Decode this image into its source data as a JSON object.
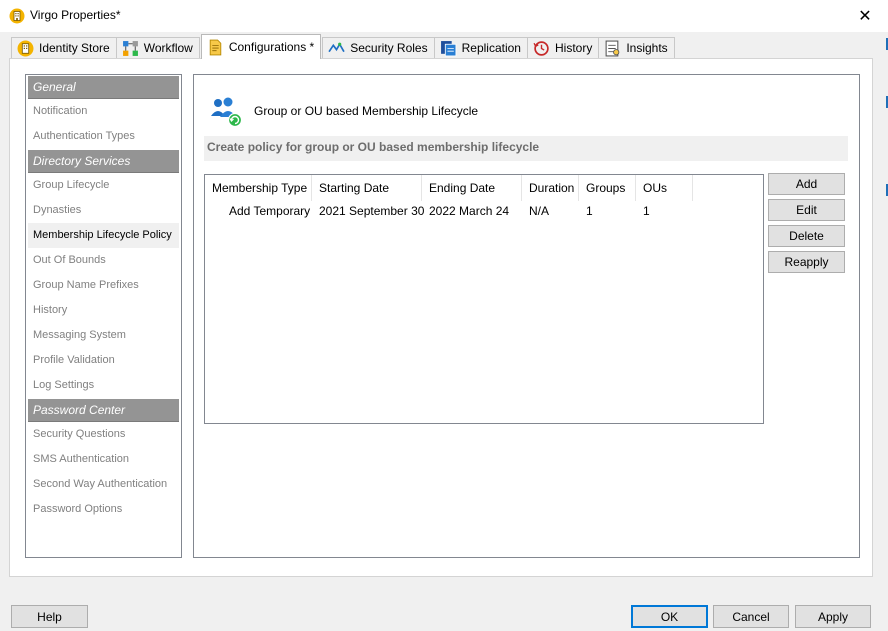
{
  "window": {
    "title": "Virgo Properties*",
    "app_icon": "building-icon",
    "close_symbol": "✕"
  },
  "tabs": [
    {
      "label": "Identity Store",
      "icon": "building-icon"
    },
    {
      "label": "Workflow",
      "icon": "workflow-icon"
    },
    {
      "label": "Configurations *",
      "icon": "document-icon",
      "active": true
    },
    {
      "label": "Security Roles",
      "icon": "security-roles-icon"
    },
    {
      "label": "Replication",
      "icon": "replication-icon"
    },
    {
      "label": "History",
      "icon": "history-icon"
    },
    {
      "label": "Insights",
      "icon": "insights-icon"
    }
  ],
  "sidebar": {
    "sections": [
      {
        "header": "General",
        "items": [
          "Notification",
          "Authentication Types"
        ]
      },
      {
        "header": "Directory Services",
        "items": [
          "Group Lifecycle",
          "Dynasties",
          "Membership Lifecycle Policy",
          "Out Of Bounds",
          "Group Name Prefixes",
          "History",
          "Messaging System",
          "Profile Validation",
          "Log Settings"
        ]
      },
      {
        "header": "Password Center",
        "items": [
          "Security Questions",
          "SMS Authentication",
          "Second Way Authentication",
          "Password Options"
        ]
      }
    ],
    "selected_item": "Membership Lifecycle Policy"
  },
  "main": {
    "heading": "Group or OU based Membership Lifecycle",
    "description": "Create policy for group or OU based membership lifecycle",
    "table": {
      "columns": [
        "Membership Type",
        "Starting Date",
        "Ending Date",
        "Duration",
        "Groups",
        "OUs"
      ],
      "rows": [
        [
          "Add Temporary",
          "2021 September 30",
          "2022 March 24",
          "N/A",
          "1",
          "1"
        ]
      ]
    },
    "side_buttons": {
      "add": "Add",
      "edit": "Edit",
      "delete": "Delete",
      "reapply": "Reapply"
    }
  },
  "footer": {
    "help": "Help",
    "ok": "OK",
    "cancel": "Cancel",
    "apply": "Apply"
  },
  "colors": {
    "accent": "#0078d7",
    "section_header": "#949494",
    "icon_blue": "#1f6fc4",
    "icon_green": "#2db84b"
  }
}
